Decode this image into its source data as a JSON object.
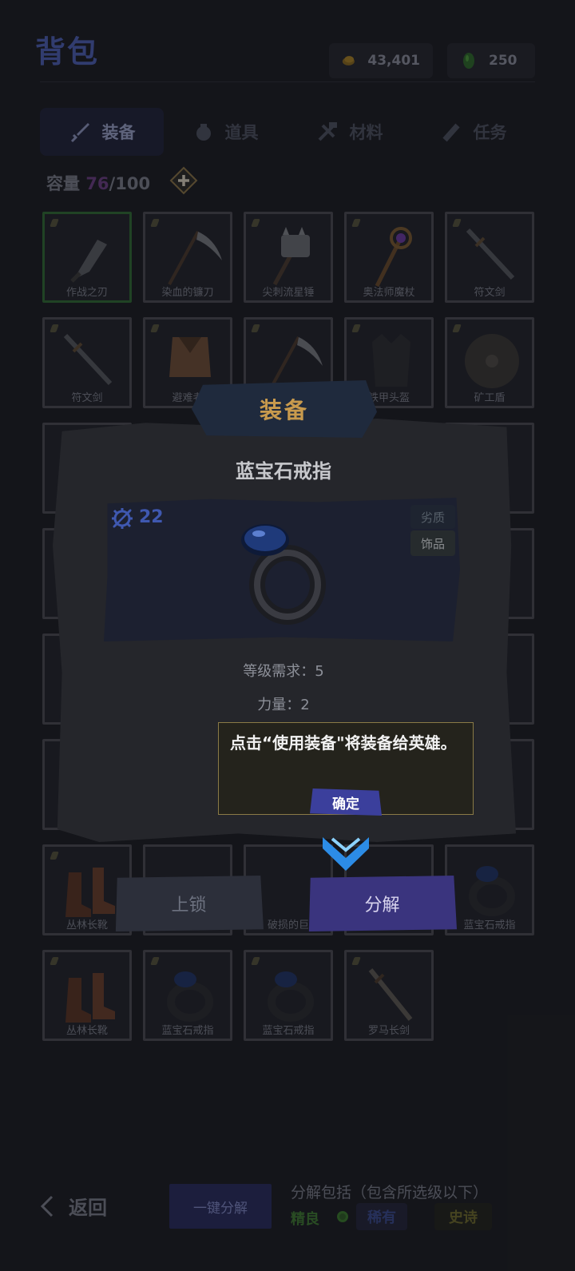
{
  "header": {
    "title": "背包",
    "gold": "43,401",
    "gems": "250"
  },
  "tabs": [
    {
      "label": "装备",
      "icon": "sword-icon",
      "active": true
    },
    {
      "label": "道具",
      "icon": "bag-icon",
      "active": false
    },
    {
      "label": "材料",
      "icon": "hammer-icon",
      "active": false
    },
    {
      "label": "任务",
      "icon": "scroll-icon",
      "active": false
    }
  ],
  "capacity": {
    "label": "容量",
    "current": "76",
    "sep": "/",
    "max": "100"
  },
  "grid": {
    "row1": [
      "作战之刃",
      "染血的镰刀",
      "尖刺流星锤",
      "奥法师魔杖",
      "符文剑"
    ],
    "row2": [
      "符文剑",
      "避难者",
      "",
      "铁甲头盔",
      "矿工盾"
    ],
    "row8": [
      "丛林长靴",
      "",
      "破损的巨",
      "",
      "蓝宝石戒指"
    ],
    "row9": [
      "丛林长靴",
      "蓝宝石戒指",
      "蓝宝石戒指",
      "罗马长剑"
    ]
  },
  "modal": {
    "header": "装备",
    "item_name": "蓝宝石戒指",
    "item_level": "22",
    "quality_tag": "劣质",
    "type_tag": "饰品",
    "stat_level": "等级需求：5",
    "stat_strength": "力量：2",
    "tip_text": "点击“使用装备\"将装备给英雄。",
    "tip_confirm": "确定",
    "lock_label": "上锁",
    "decompose_label": "分解"
  },
  "footer": {
    "back_label": "返回",
    "one_key_label": "一键分解",
    "decompose_include": "分解包括（包含所选级以下）",
    "quality_good": "精良",
    "quality_rare": "稀有",
    "quality_epic": "史诗"
  },
  "colors": {
    "accent": "#3a347e",
    "gold_text": "#c89a4d",
    "capacity_current": "#6b3f84"
  }
}
